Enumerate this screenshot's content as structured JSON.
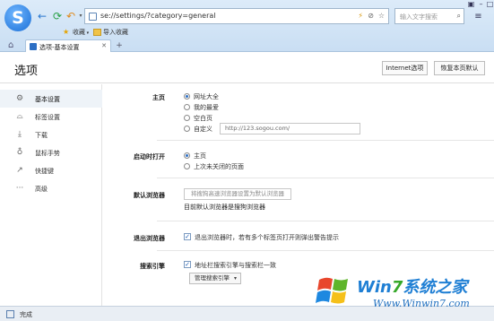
{
  "browser": {
    "logo_letter": "S",
    "url": "se://settings/?category=general",
    "search_placeholder": "输入文字搜索",
    "bookmarks": [
      "收藏",
      "导入收藏"
    ],
    "tab_title": "选项-基本设置",
    "status_text": "完成"
  },
  "header": {
    "title": "选项",
    "internet_options_label": "Internet选项",
    "restore_defaults_label": "恢复本页默认"
  },
  "sidebar": {
    "items": [
      {
        "label": "基本设置",
        "icon": "gear-icon",
        "active": true
      },
      {
        "label": "标签设置",
        "icon": "tab-icon",
        "active": false
      },
      {
        "label": "下载",
        "icon": "download-icon",
        "active": false
      },
      {
        "label": "鼠标手势",
        "icon": "mouse-icon",
        "active": false
      },
      {
        "label": "快捷键",
        "icon": "shortcut-icon",
        "active": false
      },
      {
        "label": "高级",
        "icon": "more-icon",
        "active": false
      }
    ]
  },
  "sections": {
    "homepage": {
      "label": "主页",
      "options": [
        "网址大全",
        "我的最爱",
        "空白页",
        "自定义"
      ],
      "selected": 0,
      "custom_url": "http://123.sogou.com/"
    },
    "startup": {
      "label": "启动时打开",
      "options": [
        "主页",
        "上次未关闭的页面"
      ],
      "selected": 0
    },
    "default_browser": {
      "label": "默认浏览器",
      "button_label": "将搜狗高速浏览器设置为默认浏览器",
      "status_text": "目前默认浏览器是搜狗浏览器"
    },
    "exit": {
      "label": "退出浏览器",
      "checkbox_label": "退出浏览器时，若有多个标签页打开则弹出警告提示",
      "checked": true
    },
    "search_engine": {
      "label": "搜索引擎",
      "checkbox_label": "地址栏搜索引擎与搜索栏一致",
      "checked": true,
      "manage_label": "管理搜索引擎"
    }
  },
  "watermark": {
    "brand_win": "Win",
    "brand_7": "7",
    "brand_cn": "系统之家",
    "site": "Www.Winwin7.com"
  },
  "colors": {
    "accent": "#2d6fc4",
    "chrome_bg": "#d5e6f7",
    "watermark_blue": "#1f7fd4",
    "watermark_green": "#36a82a"
  }
}
